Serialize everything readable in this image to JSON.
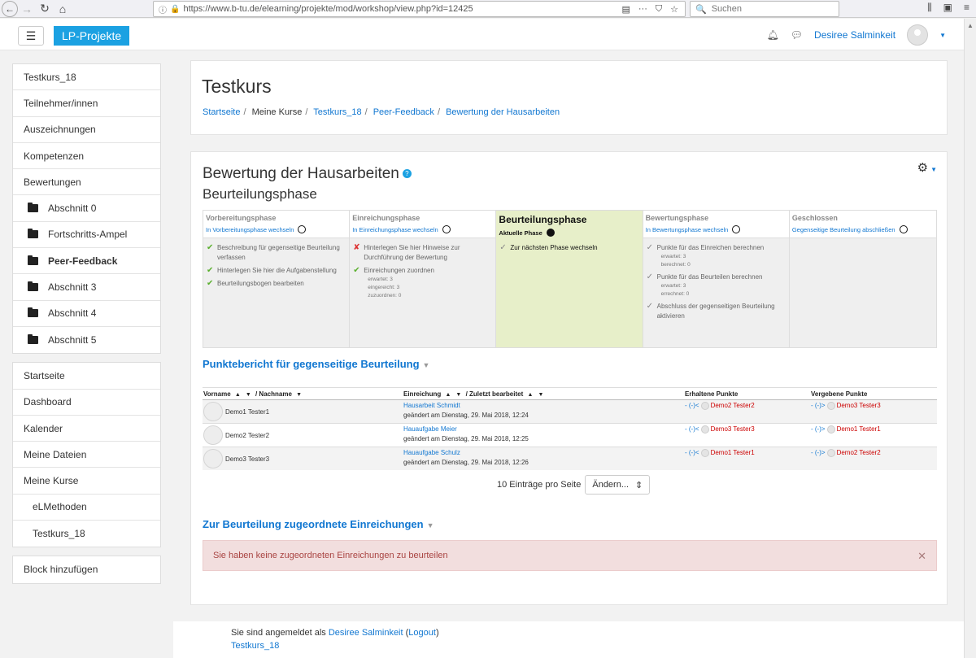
{
  "browser": {
    "url": "https://www.b-tu.de/elearning/projekte/mod/workshop/view.php?id=12425",
    "search_placeholder": "Suchen"
  },
  "navbar": {
    "brand": "LP-Projekte",
    "user_name": "Desiree Salminkeit"
  },
  "drawer": {
    "group1": [
      {
        "label": "Testkurs_18"
      },
      {
        "label": "Teilnehmer/innen"
      },
      {
        "label": "Auszeichnungen"
      },
      {
        "label": "Kompetenzen"
      },
      {
        "label": "Bewertungen"
      },
      {
        "label": "Abschnitt 0"
      },
      {
        "label": "Fortschritts-Ampel"
      },
      {
        "label": "Peer-Feedback"
      },
      {
        "label": "Abschnitt 3"
      },
      {
        "label": "Abschnitt 4"
      },
      {
        "label": "Abschnitt 5"
      }
    ],
    "group2": [
      {
        "label": "Startseite"
      },
      {
        "label": "Dashboard"
      },
      {
        "label": "Kalender"
      },
      {
        "label": "Meine Dateien"
      },
      {
        "label": "Meine Kurse"
      },
      {
        "label": "eLMethoden"
      },
      {
        "label": "Testkurs_18"
      }
    ],
    "add_block": "Block hinzufügen"
  },
  "header": {
    "course_title": "Testkurs",
    "breadcrumb": [
      "Startseite",
      "Meine Kurse",
      "Testkurs_18",
      "Peer-Feedback",
      "Bewertung der Hausarbeiten"
    ]
  },
  "main": {
    "title": "Bewertung der Hausarbeiten",
    "phase_subtitle": "Beurteilungsphase",
    "phases": [
      {
        "title": "Vorbereitungsphase",
        "link": "In Vorbereitungsphase wechseln",
        "tasks": [
          {
            "mark": "✔",
            "text": "Beschreibung für gegenseitige Beurteilung verfassen"
          },
          {
            "mark": "✔",
            "text": "Hinterlegen Sie hier die Aufgabenstellung"
          },
          {
            "mark": "✔",
            "text": "Beurteilungsbogen bearbeiten"
          }
        ]
      },
      {
        "title": "Einreichungsphase",
        "link": "In Einreichungsphase wechseln",
        "tasks": [
          {
            "mark": "✘",
            "text": "Hinterlegen Sie hier Hinweise zur Durchführung der Bewertung"
          },
          {
            "mark": "✔",
            "text": "Einreichungen zuordnen"
          }
        ],
        "info": [
          "erwartet: 3",
          "eingereicht: 3",
          "zuzuordnen: 0"
        ]
      },
      {
        "title": "Beurteilungsphase",
        "link": "Aktuelle Phase",
        "tasks": [
          {
            "mark": "✓",
            "text": "Zur nächsten Phase wechseln"
          }
        ]
      },
      {
        "title": "Bewertungsphase",
        "link": "In Bewertungsphase wechseln",
        "tasks": [
          {
            "mark": "✓",
            "text": "Punkte für das Einreichen berechnen",
            "info": [
              "erwartet: 3",
              "berechnet: 0"
            ]
          },
          {
            "mark": "✓",
            "text": "Punkte für das Beurteilen berechnen",
            "info": [
              "erwartet: 3",
              "errechnet: 0"
            ]
          },
          {
            "mark": "✓",
            "text": "Abschluss der gegenseitigen Beurteilung aktivieren"
          }
        ]
      },
      {
        "title": "Geschlossen",
        "link": "Gegenseitige Beurteilung abschließen",
        "tasks": []
      }
    ],
    "report_heading": "Punktebericht für gegenseitige Beurteilung",
    "table": {
      "headers": {
        "vorname": "Vorname",
        "nachname": "/ Nachname",
        "einreichung": "Einreichung",
        "zuletzt": "/ Zuletzt bearbeitet",
        "erhaltene": "Erhaltene Punkte",
        "vergebene": "Vergebene Punkte"
      },
      "rows": [
        {
          "name": "Demo1 Tester1",
          "submission": "Hausarbeit Schmidt",
          "modified": "geändert am Dienstag, 29. Mai 2018, 12:24",
          "received_prefix": "- (-)<",
          "received_from": "Demo2 Tester2",
          "given_prefix": "- (-)>",
          "given_to": "Demo3 Tester3"
        },
        {
          "name": "Demo2 Tester2",
          "submission": "Hauaufgabe Meier",
          "modified": "geändert am Dienstag, 29. Mai 2018, 12:25",
          "received_prefix": "- (-)<",
          "received_from": "Demo3 Tester3",
          "given_prefix": "- (-)>",
          "given_to": "Demo1 Tester1"
        },
        {
          "name": "Demo3 Tester3",
          "submission": "Hauaufgabe Schulz",
          "modified": "geändert am Dienstag, 29. Mai 2018, 12:26",
          "received_prefix": "- (-)<",
          "received_from": "Demo1 Tester1",
          "given_prefix": "- (-)>",
          "given_to": "Demo2 Tester2"
        }
      ]
    },
    "per_page_label": "10 Einträge pro Seite",
    "per_page_select": "Ändern...",
    "assigned_heading": "Zur Beurteilung zugeordnete Einreichungen",
    "alert_text": "Sie haben keine zugeordneten Einreichungen zu beurteilen"
  },
  "footer": {
    "logged_in_prefix": "Sie sind angemeldet als",
    "user": "Desiree Salminkeit",
    "logout": "Logout",
    "course": "Testkurs_18"
  }
}
